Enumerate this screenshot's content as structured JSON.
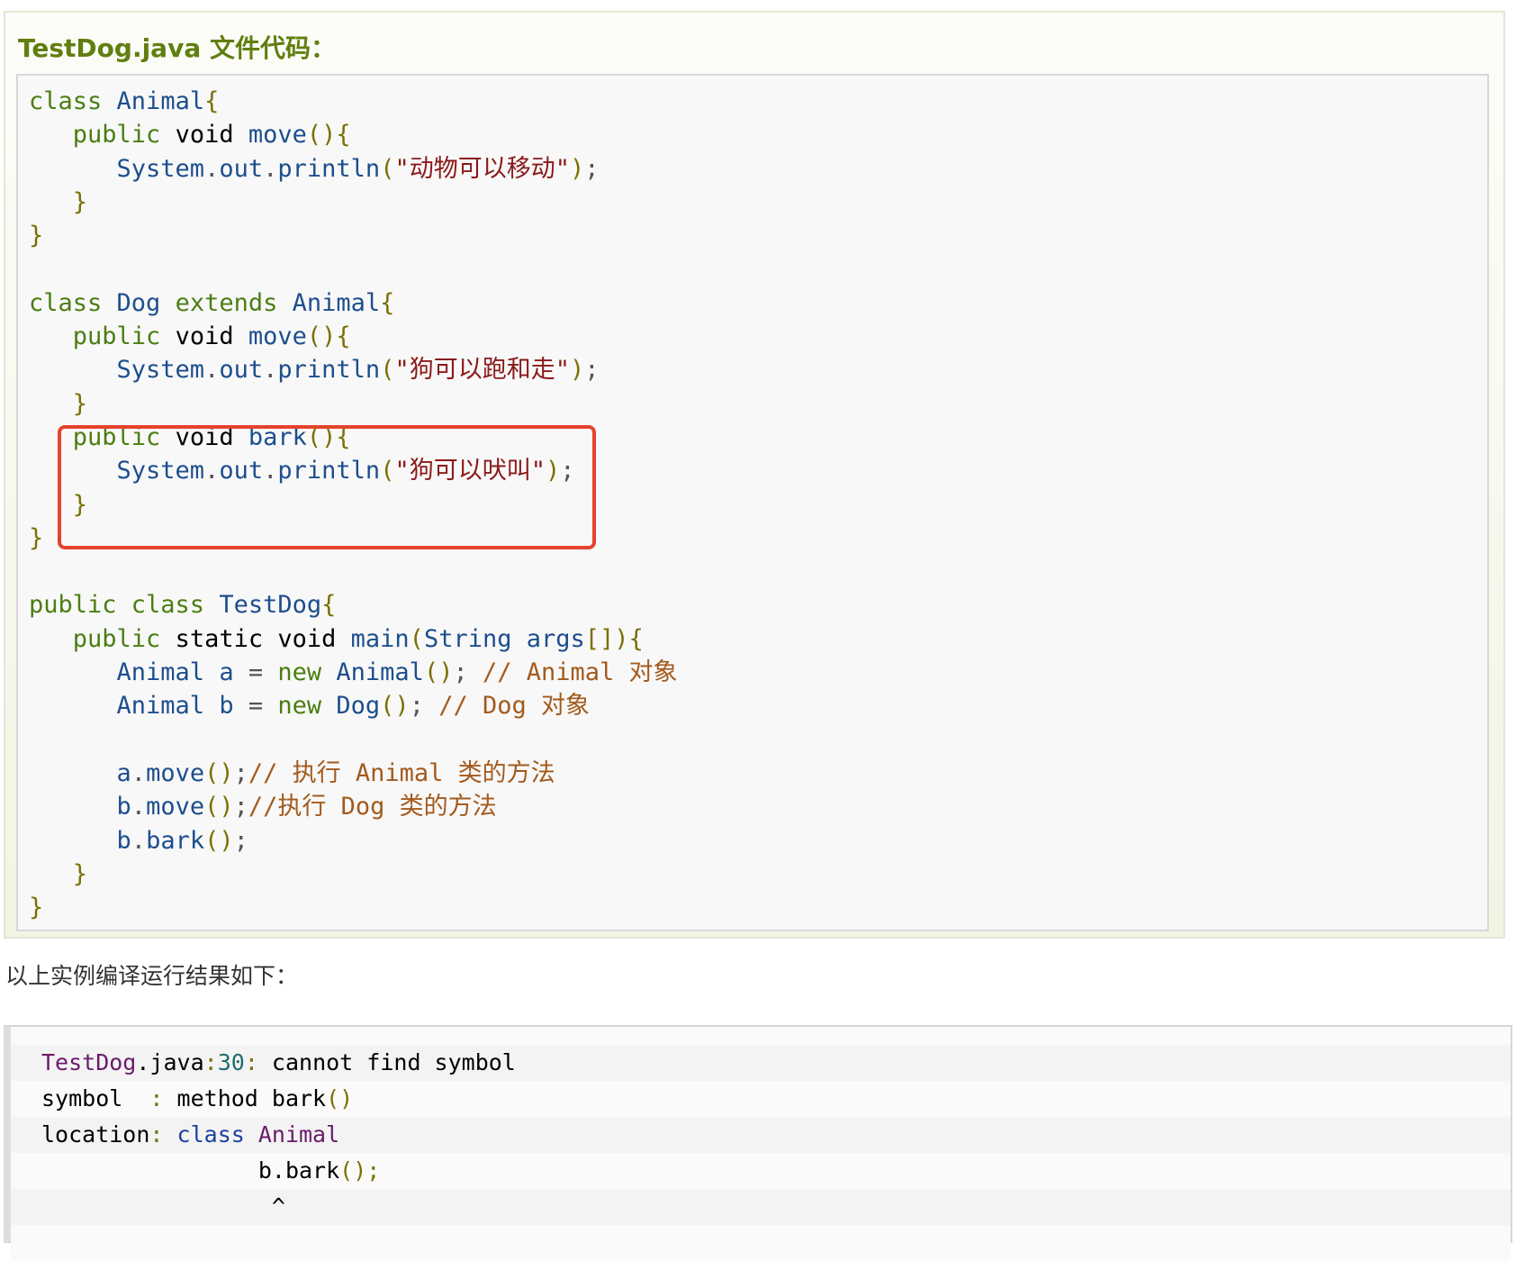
{
  "example": {
    "title": "TestDog.java 文件代码：",
    "code_lines": [
      [
        [
          "kw",
          "class "
        ],
        [
          "id",
          "Animal"
        ],
        [
          "pn",
          "{"
        ]
      ],
      [
        [
          "kw",
          "   public "
        ],
        [
          "typ",
          "void "
        ],
        [
          "id",
          "move"
        ],
        [
          "pn",
          "(){"
        ]
      ],
      [
        [
          "id",
          "      System"
        ],
        [
          "punc",
          "."
        ],
        [
          "id",
          "out"
        ],
        [
          "punc",
          "."
        ],
        [
          "id",
          "println"
        ],
        [
          "pn",
          "("
        ],
        [
          "str",
          "\"动物可以移动\""
        ],
        [
          "pn",
          ")"
        ],
        [
          "punc",
          ";"
        ]
      ],
      [
        [
          "pn",
          "   }"
        ]
      ],
      [
        [
          "pn",
          "}"
        ]
      ],
      [],
      [
        [
          "kw",
          "class "
        ],
        [
          "id",
          "Dog "
        ],
        [
          "kw",
          "extends "
        ],
        [
          "id",
          "Animal"
        ],
        [
          "pn",
          "{"
        ]
      ],
      [
        [
          "kw",
          "   public "
        ],
        [
          "typ",
          "void "
        ],
        [
          "id",
          "move"
        ],
        [
          "pn",
          "(){"
        ]
      ],
      [
        [
          "id",
          "      System"
        ],
        [
          "punc",
          "."
        ],
        [
          "id",
          "out"
        ],
        [
          "punc",
          "."
        ],
        [
          "id",
          "println"
        ],
        [
          "pn",
          "("
        ],
        [
          "str",
          "\"狗可以跑和走\""
        ],
        [
          "pn",
          ")"
        ],
        [
          "punc",
          ";"
        ]
      ],
      [
        [
          "pn",
          "   }"
        ]
      ],
      [
        [
          "kw",
          "   public "
        ],
        [
          "typ",
          "void "
        ],
        [
          "id",
          "bark"
        ],
        [
          "pn",
          "(){"
        ]
      ],
      [
        [
          "id",
          "      System"
        ],
        [
          "punc",
          "."
        ],
        [
          "id",
          "out"
        ],
        [
          "punc",
          "."
        ],
        [
          "id",
          "println"
        ],
        [
          "pn",
          "("
        ],
        [
          "str",
          "\"狗可以吠叫\""
        ],
        [
          "pn",
          ")"
        ],
        [
          "punc",
          ";"
        ]
      ],
      [
        [
          "pn",
          "   }"
        ]
      ],
      [
        [
          "pn",
          "}"
        ]
      ],
      [],
      [
        [
          "kw",
          "public class "
        ],
        [
          "id",
          "TestDog"
        ],
        [
          "pn",
          "{"
        ]
      ],
      [
        [
          "kw",
          "   public "
        ],
        [
          "typ",
          "static void "
        ],
        [
          "id",
          "main"
        ],
        [
          "pn",
          "("
        ],
        [
          "id",
          "String args"
        ],
        [
          "pn",
          "[]){"
        ]
      ],
      [
        [
          "id",
          "      Animal a "
        ],
        [
          "punc",
          "= "
        ],
        [
          "kw",
          "new "
        ],
        [
          "id",
          "Animal"
        ],
        [
          "pn",
          "()"
        ],
        [
          "punc",
          "; "
        ],
        [
          "cm",
          "// Animal 对象"
        ]
      ],
      [
        [
          "id",
          "      Animal b "
        ],
        [
          "punc",
          "= "
        ],
        [
          "kw",
          "new "
        ],
        [
          "id",
          "Dog"
        ],
        [
          "pn",
          "()"
        ],
        [
          "punc",
          "; "
        ],
        [
          "cm",
          "// Dog 对象"
        ]
      ],
      [],
      [
        [
          "id",
          "      a"
        ],
        [
          "punc",
          "."
        ],
        [
          "id",
          "move"
        ],
        [
          "pn",
          "()"
        ],
        [
          "punc",
          ";"
        ],
        [
          "cm",
          "// 执行 Animal 类的方法"
        ]
      ],
      [
        [
          "id",
          "      b"
        ],
        [
          "punc",
          "."
        ],
        [
          "id",
          "move"
        ],
        [
          "pn",
          "()"
        ],
        [
          "punc",
          ";"
        ],
        [
          "cm",
          "//执行 Dog 类的方法"
        ]
      ],
      [
        [
          "id",
          "      b"
        ],
        [
          "punc",
          "."
        ],
        [
          "id",
          "bark"
        ],
        [
          "pn",
          "()"
        ],
        [
          "punc",
          ";"
        ]
      ],
      [
        [
          "pn",
          "   }"
        ]
      ],
      [
        [
          "pn",
          "}"
        ]
      ]
    ]
  },
  "caption": "以上实例编译运行结果如下：",
  "output": {
    "lines": [
      [
        [
          "o-cls",
          "TestDog"
        ],
        [
          "",
          "."
        ],
        [
          "",
          "java"
        ],
        [
          "o-pn",
          ":"
        ],
        [
          "o-num",
          "30"
        ],
        [
          "o-pn",
          ":"
        ],
        [
          "",
          " cannot find symbol"
        ]
      ],
      [
        [
          "",
          "symbol  "
        ],
        [
          "o-pn",
          ":"
        ],
        [
          "",
          " method bark"
        ],
        [
          "o-pn",
          "()"
        ]
      ],
      [
        [
          "",
          "location"
        ],
        [
          "o-pn",
          ":"
        ],
        [
          "o-kw",
          " class "
        ],
        [
          "o-cls",
          "Animal"
        ]
      ],
      [
        [
          "",
          "                b"
        ],
        [
          "",
          "."
        ],
        [
          "",
          "bark"
        ],
        [
          "o-pn",
          "();"
        ]
      ],
      [
        [
          "",
          "                 ^"
        ]
      ],
      []
    ]
  },
  "colors": {
    "title_green": "#617f10",
    "highlight_red": "#e5432d"
  }
}
